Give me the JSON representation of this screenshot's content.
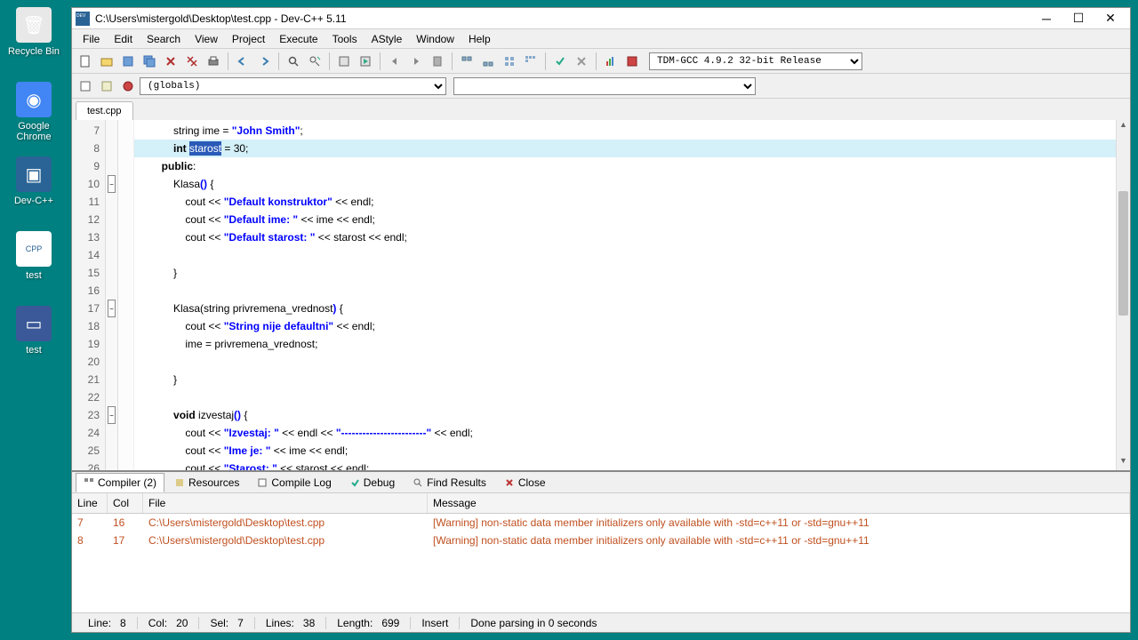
{
  "desktop": [
    {
      "name": "recycle-bin",
      "label": "Recycle Bin",
      "color": "#e8e8e8",
      "glyph": "🗑"
    },
    {
      "name": "chrome",
      "label": "Google Chrome",
      "color": "#4285f4",
      "glyph": "◉"
    },
    {
      "name": "devcpp",
      "label": "Dev-C++",
      "color": "#2a6496",
      "glyph": "▣"
    },
    {
      "name": "test-cpp",
      "label": "test",
      "color": "#fff",
      "glyph": "CPP"
    },
    {
      "name": "test-exe",
      "label": "test",
      "color": "#3b5998",
      "glyph": "▭"
    }
  ],
  "window": {
    "title": "C:\\Users\\mistergold\\Desktop\\test.cpp - Dev-C++ 5.11",
    "menus": [
      "File",
      "Edit",
      "Search",
      "View",
      "Project",
      "Execute",
      "Tools",
      "AStyle",
      "Window",
      "Help"
    ],
    "compiler_select": "TDM-GCC 4.9.2 32-bit Release",
    "globals_combo": "(globals)",
    "tab": "test.cpp"
  },
  "code_lines": [
    {
      "n": 7,
      "indent": 3,
      "tokens": [
        {
          "t": "string ime = ",
          "c": ""
        },
        {
          "t": "\"John Smith\"",
          "c": "str"
        },
        {
          "t": ";",
          "c": ""
        }
      ]
    },
    {
      "n": 8,
      "indent": 3,
      "hl": true,
      "tokens": [
        {
          "t": "int ",
          "c": "kw"
        },
        {
          "t": "starost",
          "c": "sel"
        },
        {
          "t": " = 30;",
          "c": ""
        }
      ]
    },
    {
      "n": 9,
      "indent": 2,
      "tokens": [
        {
          "t": "public",
          "c": "kw"
        },
        {
          "t": ":",
          "c": ""
        }
      ]
    },
    {
      "n": 10,
      "indent": 3,
      "fold": true,
      "tokens": [
        {
          "t": "Klasa",
          "c": ""
        },
        {
          "t": "()",
          "c": "str"
        },
        {
          "t": " {",
          "c": ""
        }
      ]
    },
    {
      "n": 11,
      "indent": 4,
      "tokens": [
        {
          "t": "cout << ",
          "c": ""
        },
        {
          "t": "\"Default konstruktor\"",
          "c": "str"
        },
        {
          "t": " << endl;",
          "c": ""
        }
      ]
    },
    {
      "n": 12,
      "indent": 4,
      "tokens": [
        {
          "t": "cout << ",
          "c": ""
        },
        {
          "t": "\"Default ime: \"",
          "c": "str"
        },
        {
          "t": " << ime << endl;",
          "c": ""
        }
      ]
    },
    {
      "n": 13,
      "indent": 4,
      "tokens": [
        {
          "t": "cout << ",
          "c": ""
        },
        {
          "t": "\"Default starost: \"",
          "c": "str"
        },
        {
          "t": " << starost << endl;",
          "c": ""
        }
      ]
    },
    {
      "n": 14,
      "indent": 4,
      "tokens": []
    },
    {
      "n": 15,
      "indent": 3,
      "tokens": [
        {
          "t": "}",
          "c": ""
        }
      ]
    },
    {
      "n": 16,
      "indent": 0,
      "tokens": []
    },
    {
      "n": 17,
      "indent": 3,
      "fold": true,
      "tokens": [
        {
          "t": "Klasa(string privremena_vrednost",
          "c": ""
        },
        {
          "t": ")",
          "c": "str"
        },
        {
          "t": " {",
          "c": ""
        }
      ]
    },
    {
      "n": 18,
      "indent": 4,
      "tokens": [
        {
          "t": "cout << ",
          "c": ""
        },
        {
          "t": "\"String nije defaultni\"",
          "c": "str"
        },
        {
          "t": " << endl;",
          "c": ""
        }
      ]
    },
    {
      "n": 19,
      "indent": 4,
      "tokens": [
        {
          "t": "ime = privremena_vrednost;",
          "c": ""
        }
      ]
    },
    {
      "n": 20,
      "indent": 4,
      "tokens": []
    },
    {
      "n": 21,
      "indent": 3,
      "tokens": [
        {
          "t": "}",
          "c": ""
        }
      ]
    },
    {
      "n": 22,
      "indent": 0,
      "tokens": []
    },
    {
      "n": 23,
      "indent": 3,
      "fold": true,
      "tokens": [
        {
          "t": "void ",
          "c": "kw"
        },
        {
          "t": "izvestaj",
          "c": ""
        },
        {
          "t": "()",
          "c": "str"
        },
        {
          "t": " {",
          "c": ""
        }
      ]
    },
    {
      "n": 24,
      "indent": 4,
      "tokens": [
        {
          "t": "cout << ",
          "c": ""
        },
        {
          "t": "\"Izvestaj: \"",
          "c": "str"
        },
        {
          "t": " << endl << ",
          "c": ""
        },
        {
          "t": "\"------------------------\"",
          "c": "str"
        },
        {
          "t": " << endl;",
          "c": ""
        }
      ]
    },
    {
      "n": 25,
      "indent": 4,
      "tokens": [
        {
          "t": "cout << ",
          "c": ""
        },
        {
          "t": "\"Ime je: \"",
          "c": "str"
        },
        {
          "t": " << ime << endl;",
          "c": ""
        }
      ]
    },
    {
      "n": 26,
      "indent": 4,
      "tokens": [
        {
          "t": "cout << ",
          "c": ""
        },
        {
          "t": "\"Starost: \"",
          "c": "str"
        },
        {
          "t": " << starost << endl;",
          "c": ""
        }
      ]
    }
  ],
  "bottom_tabs": {
    "compiler": "Compiler (2)",
    "resources": "Resources",
    "compile_log": "Compile Log",
    "debug": "Debug",
    "find": "Find Results",
    "close": "Close"
  },
  "compiler_headers": {
    "line": "Line",
    "col": "Col",
    "file": "File",
    "msg": "Message"
  },
  "compiler_rows": [
    {
      "line": "7",
      "col": "16",
      "file": "C:\\Users\\mistergold\\Desktop\\test.cpp",
      "msg": "[Warning] non-static data member initializers only available with -std=c++11 or -std=gnu++11"
    },
    {
      "line": "8",
      "col": "17",
      "file": "C:\\Users\\mistergold\\Desktop\\test.cpp",
      "msg": "[Warning] non-static data member initializers only available with -std=c++11 or -std=gnu++11"
    }
  ],
  "status": {
    "line_lbl": "Line:",
    "line": "8",
    "col_lbl": "Col:",
    "col": "20",
    "sel_lbl": "Sel:",
    "sel": "7",
    "lines_lbl": "Lines:",
    "lines": "38",
    "length_lbl": "Length:",
    "length": "699",
    "mode": "Insert",
    "parse": "Done parsing in 0 seconds"
  }
}
